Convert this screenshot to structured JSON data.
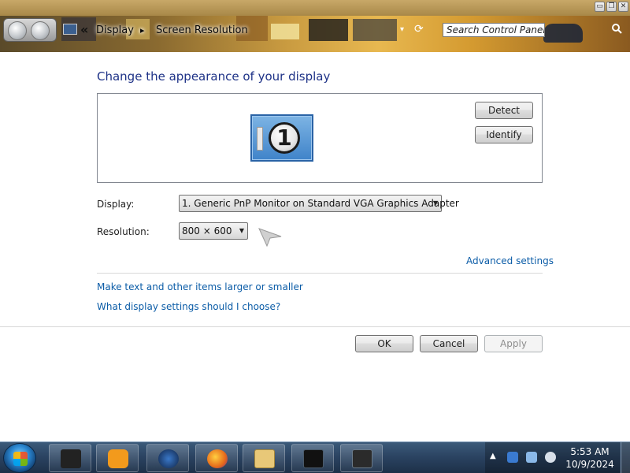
{
  "window": {
    "controls": {
      "minimize": "▭",
      "maximize": "❐",
      "close": "✕"
    }
  },
  "address_bar": {
    "chevron": "«",
    "crumbs": [
      "Display",
      "Screen Resolution"
    ],
    "separator": "▸",
    "dropdown": "▾",
    "refresh": "⟳"
  },
  "search": {
    "placeholder": "Search Control Panel"
  },
  "content": {
    "heading": "Change the appearance of your display",
    "monitor_number": "1",
    "detect_label": "Detect",
    "identify_label": "Identify",
    "display_label": "Display:",
    "display_value": "1. Generic PnP Monitor on Standard VGA Graphics Adapter",
    "resolution_label": "Resolution:",
    "resolution_value": "800 × 600",
    "advanced_link": "Advanced settings",
    "larger_link": "Make text and other items larger or smaller",
    "what_link": "What display settings should I choose?",
    "ok_label": "OK",
    "cancel_label": "Cancel",
    "apply_label": "Apply"
  },
  "taskbar": {
    "apps": [
      {
        "icon": "monitor-app-icon",
        "color": "#222222"
      },
      {
        "icon": "media-player-icon",
        "color": "#f39a1c"
      },
      {
        "icon": "globe-icon",
        "color": "#1b3f7a"
      },
      {
        "icon": "firefox-icon",
        "color": "#e66a1a"
      },
      {
        "icon": "explorer-folder-icon",
        "color": "#e8c878"
      },
      {
        "icon": "terminal-window-icon",
        "color": "#111111"
      },
      {
        "icon": "dark-app-icon",
        "color": "#2b2b2b"
      }
    ],
    "tray_expand": "▲",
    "time": "5:53 AM",
    "date": "10/9/2024"
  },
  "colors": {
    "heading": "#1e3287",
    "link": "#0b5ca7",
    "taskbar": "#2a4260"
  }
}
